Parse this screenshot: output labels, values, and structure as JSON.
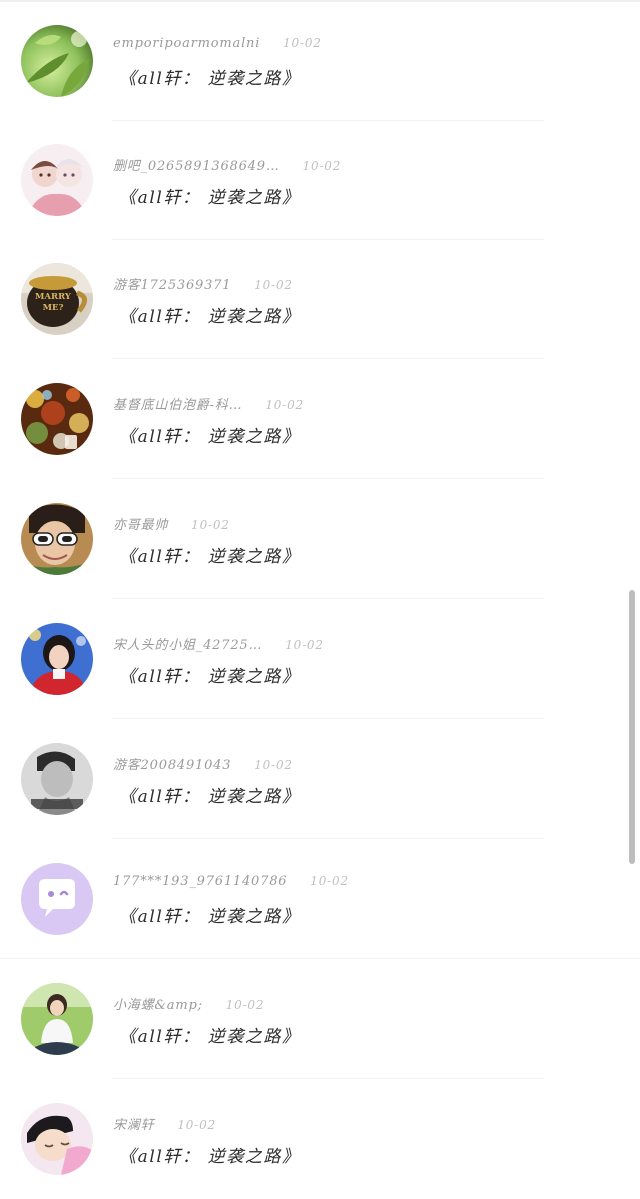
{
  "comment_list": [
    {
      "username": "emporipoarmomalni",
      "date": "10-02",
      "message": "《all轩： 逆袭之路》",
      "avatar_icon": "leaf-photo-avatar"
    },
    {
      "username": "删吧_0265891368649…",
      "date": "10-02",
      "message": "《all轩： 逆袭之路》",
      "avatar_icon": "anime-illustration-avatar"
    },
    {
      "username": "游客1725369371",
      "date": "10-02",
      "message": "《all轩： 逆袭之路》",
      "avatar_icon": "marry-me-mug-avatar",
      "avatar_text": "MARRY ME?"
    },
    {
      "username": "基督底山伯泡爵-科…",
      "date": "10-02",
      "message": "《all轩： 逆袭之路》",
      "avatar_icon": "bokeh-lights-avatar"
    },
    {
      "username": "亦哥最帅",
      "date": "10-02",
      "message": "《all轩： 逆袭之路》",
      "avatar_icon": "sunglasses-person-avatar"
    },
    {
      "username": "宋人头的小姐_42725…",
      "date": "10-02",
      "message": "《all轩： 逆袭之路》",
      "avatar_icon": "girl-red-outfit-avatar"
    },
    {
      "username": "游客2008491043",
      "date": "10-02",
      "message": "《all轩： 逆袭之路》",
      "avatar_icon": "grayscale-boy-avatar"
    },
    {
      "username": "177***193_9761140786",
      "date": "10-02",
      "message": "《all轩： 逆袭之路》",
      "avatar_icon": "default-chat-bubble-avatar"
    },
    {
      "username": "小海螺&amp;",
      "date": "10-02",
      "message": "《all轩： 逆袭之路》",
      "avatar_icon": "boy-on-grass-avatar"
    },
    {
      "username": "宋澜轩",
      "date": "10-02",
      "message": "《all轩： 逆袭之路》",
      "avatar_icon": "sleeping-child-avatar"
    }
  ],
  "colors": {
    "username": "#9a9a9a",
    "date": "#c0c0c0",
    "message": "#2c2c2c",
    "default_avatar_bg": "#d9c8f3"
  }
}
